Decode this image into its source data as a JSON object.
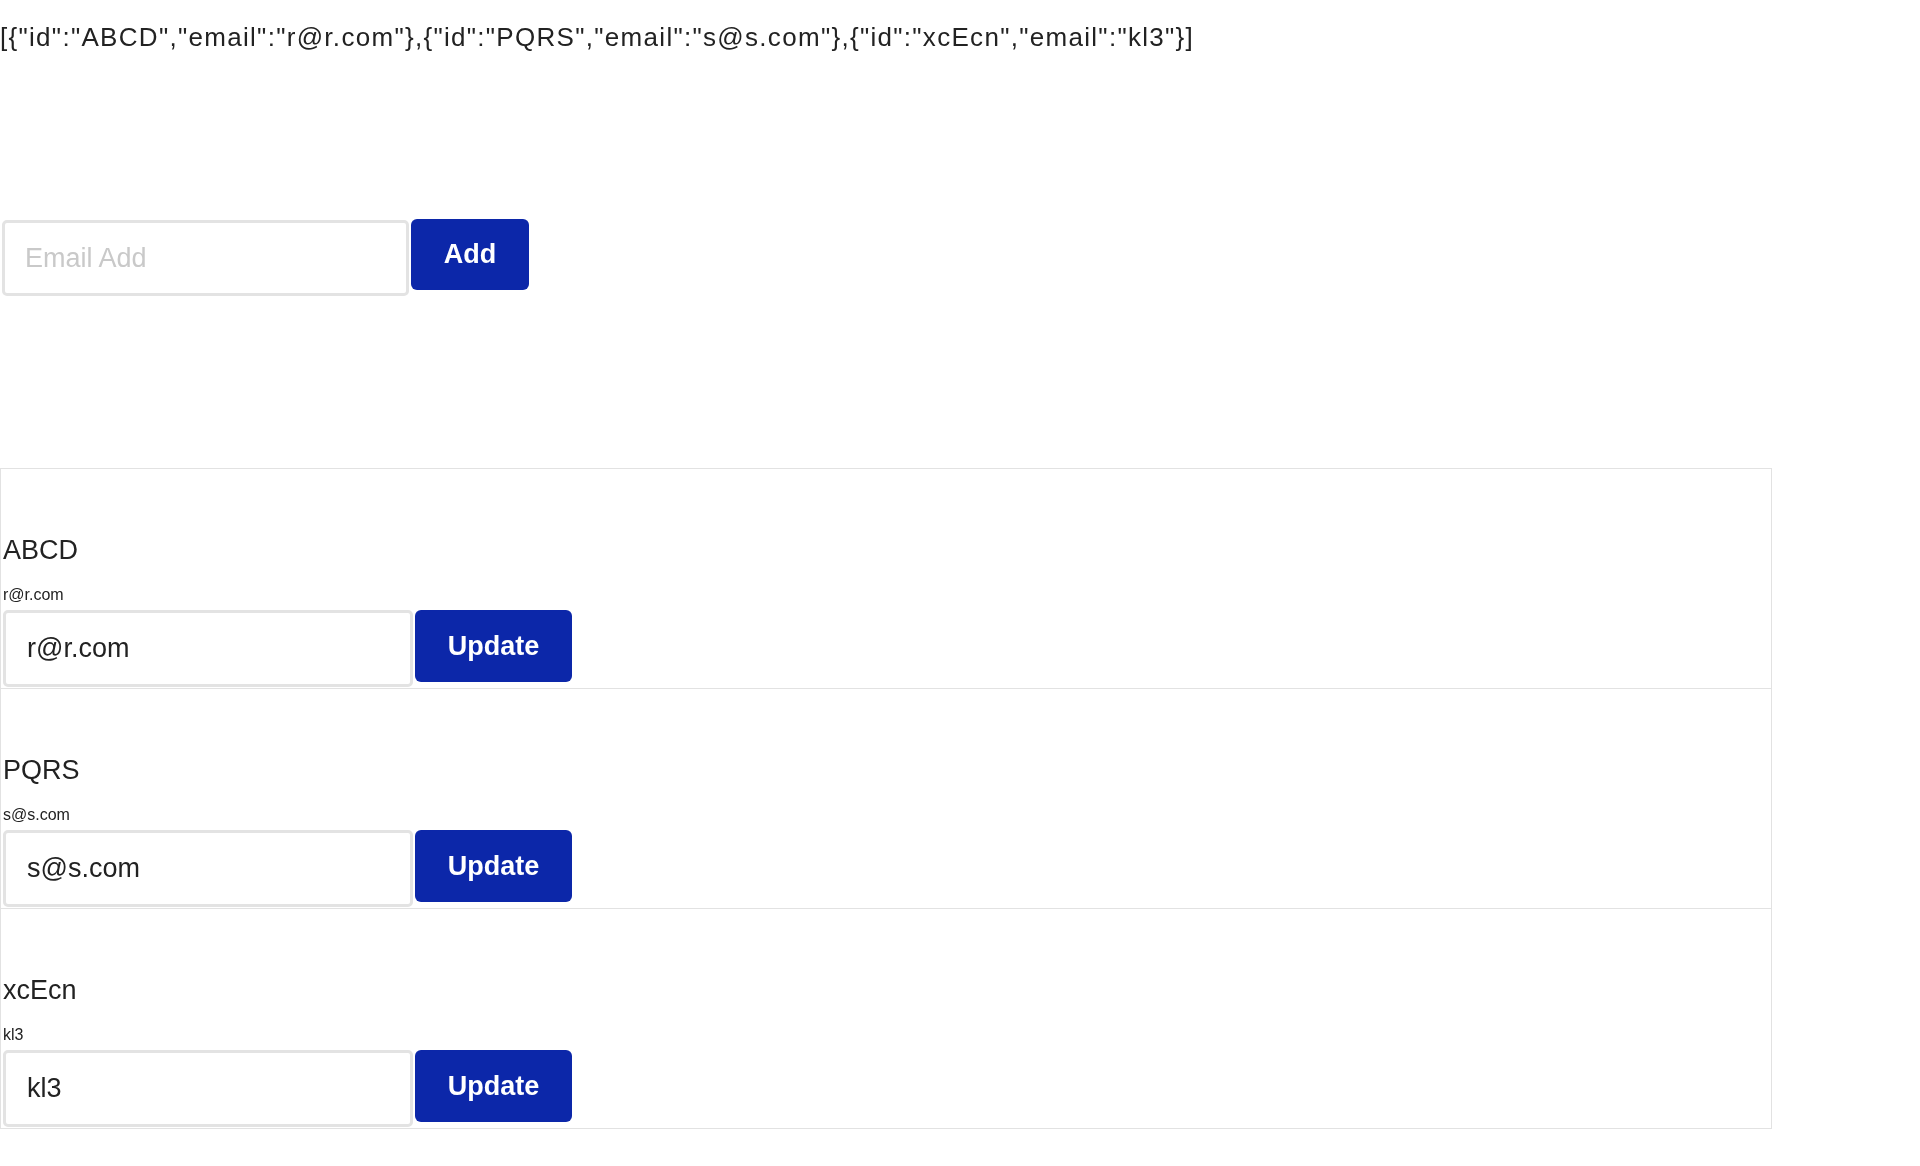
{
  "output_text": "[{\"id\":\"ABCD\",\"email\":\"r@r.com\"},{\"id\":\"PQRS\",\"email\":\"s@s.com\"},{\"id\":\"xcEcn\",\"email\":\"kl3\"}]",
  "add_form": {
    "email_field": {
      "placeholder": "Email Add"
    },
    "button": "Add"
  },
  "entries": [
    {
      "id_label": "ABCD",
      "email_label": "r@r.com",
      "email_field": {
        "value": "r@r.com"
      },
      "button": "Update"
    },
    {
      "id_label": "PQRS",
      "email_label": "s@s.com",
      "email_field": {
        "value": "s@s.com"
      },
      "button": "Update"
    },
    {
      "id_label": "xcEcn",
      "email_label": "kl3",
      "email_field": {
        "value": "kl3"
      },
      "button": "Update"
    }
  ]
}
